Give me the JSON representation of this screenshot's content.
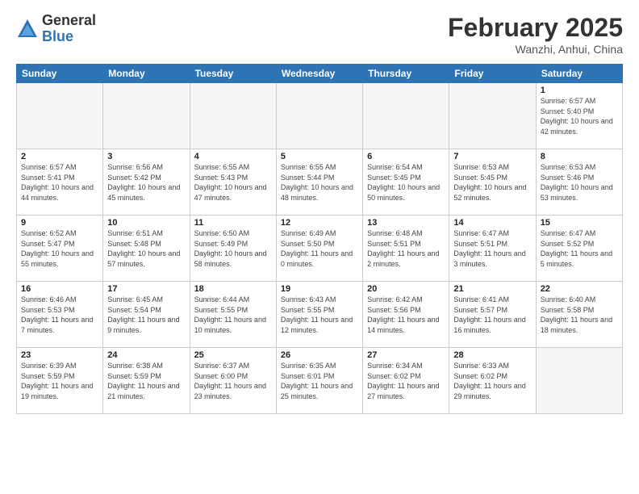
{
  "logo": {
    "general": "General",
    "blue": "Blue"
  },
  "title": "February 2025",
  "subtitle": "Wanzhi, Anhui, China",
  "days_header": [
    "Sunday",
    "Monday",
    "Tuesday",
    "Wednesday",
    "Thursday",
    "Friday",
    "Saturday"
  ],
  "weeks": [
    [
      {
        "day": "",
        "info": ""
      },
      {
        "day": "",
        "info": ""
      },
      {
        "day": "",
        "info": ""
      },
      {
        "day": "",
        "info": ""
      },
      {
        "day": "",
        "info": ""
      },
      {
        "day": "",
        "info": ""
      },
      {
        "day": "1",
        "info": "Sunrise: 6:57 AM\nSunset: 5:40 PM\nDaylight: 10 hours\nand 42 minutes."
      }
    ],
    [
      {
        "day": "2",
        "info": "Sunrise: 6:57 AM\nSunset: 5:41 PM\nDaylight: 10 hours\nand 44 minutes."
      },
      {
        "day": "3",
        "info": "Sunrise: 6:56 AM\nSunset: 5:42 PM\nDaylight: 10 hours\nand 45 minutes."
      },
      {
        "day": "4",
        "info": "Sunrise: 6:55 AM\nSunset: 5:43 PM\nDaylight: 10 hours\nand 47 minutes."
      },
      {
        "day": "5",
        "info": "Sunrise: 6:55 AM\nSunset: 5:44 PM\nDaylight: 10 hours\nand 48 minutes."
      },
      {
        "day": "6",
        "info": "Sunrise: 6:54 AM\nSunset: 5:45 PM\nDaylight: 10 hours\nand 50 minutes."
      },
      {
        "day": "7",
        "info": "Sunrise: 6:53 AM\nSunset: 5:45 PM\nDaylight: 10 hours\nand 52 minutes."
      },
      {
        "day": "8",
        "info": "Sunrise: 6:53 AM\nSunset: 5:46 PM\nDaylight: 10 hours\nand 53 minutes."
      }
    ],
    [
      {
        "day": "9",
        "info": "Sunrise: 6:52 AM\nSunset: 5:47 PM\nDaylight: 10 hours\nand 55 minutes."
      },
      {
        "day": "10",
        "info": "Sunrise: 6:51 AM\nSunset: 5:48 PM\nDaylight: 10 hours\nand 57 minutes."
      },
      {
        "day": "11",
        "info": "Sunrise: 6:50 AM\nSunset: 5:49 PM\nDaylight: 10 hours\nand 58 minutes."
      },
      {
        "day": "12",
        "info": "Sunrise: 6:49 AM\nSunset: 5:50 PM\nDaylight: 11 hours\nand 0 minutes."
      },
      {
        "day": "13",
        "info": "Sunrise: 6:48 AM\nSunset: 5:51 PM\nDaylight: 11 hours\nand 2 minutes."
      },
      {
        "day": "14",
        "info": "Sunrise: 6:47 AM\nSunset: 5:51 PM\nDaylight: 11 hours\nand 3 minutes."
      },
      {
        "day": "15",
        "info": "Sunrise: 6:47 AM\nSunset: 5:52 PM\nDaylight: 11 hours\nand 5 minutes."
      }
    ],
    [
      {
        "day": "16",
        "info": "Sunrise: 6:46 AM\nSunset: 5:53 PM\nDaylight: 11 hours\nand 7 minutes."
      },
      {
        "day": "17",
        "info": "Sunrise: 6:45 AM\nSunset: 5:54 PM\nDaylight: 11 hours\nand 9 minutes."
      },
      {
        "day": "18",
        "info": "Sunrise: 6:44 AM\nSunset: 5:55 PM\nDaylight: 11 hours\nand 10 minutes."
      },
      {
        "day": "19",
        "info": "Sunrise: 6:43 AM\nSunset: 5:55 PM\nDaylight: 11 hours\nand 12 minutes."
      },
      {
        "day": "20",
        "info": "Sunrise: 6:42 AM\nSunset: 5:56 PM\nDaylight: 11 hours\nand 14 minutes."
      },
      {
        "day": "21",
        "info": "Sunrise: 6:41 AM\nSunset: 5:57 PM\nDaylight: 11 hours\nand 16 minutes."
      },
      {
        "day": "22",
        "info": "Sunrise: 6:40 AM\nSunset: 5:58 PM\nDaylight: 11 hours\nand 18 minutes."
      }
    ],
    [
      {
        "day": "23",
        "info": "Sunrise: 6:39 AM\nSunset: 5:59 PM\nDaylight: 11 hours\nand 19 minutes."
      },
      {
        "day": "24",
        "info": "Sunrise: 6:38 AM\nSunset: 5:59 PM\nDaylight: 11 hours\nand 21 minutes."
      },
      {
        "day": "25",
        "info": "Sunrise: 6:37 AM\nSunset: 6:00 PM\nDaylight: 11 hours\nand 23 minutes."
      },
      {
        "day": "26",
        "info": "Sunrise: 6:35 AM\nSunset: 6:01 PM\nDaylight: 11 hours\nand 25 minutes."
      },
      {
        "day": "27",
        "info": "Sunrise: 6:34 AM\nSunset: 6:02 PM\nDaylight: 11 hours\nand 27 minutes."
      },
      {
        "day": "28",
        "info": "Sunrise: 6:33 AM\nSunset: 6:02 PM\nDaylight: 11 hours\nand 29 minutes."
      },
      {
        "day": "",
        "info": ""
      }
    ]
  ]
}
